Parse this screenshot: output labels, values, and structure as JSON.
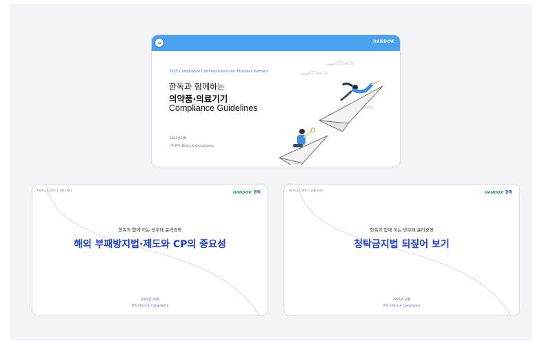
{
  "cards": [
    {
      "brand": "HANDOK",
      "subtitle": "2025 Compliance Communication for Business Partners",
      "title_line1": "한독과 함께하는",
      "title_line2": "의약품·의료기기",
      "title_line3": "Compliance Guidelines",
      "date": "2025년 8월",
      "org": "(주)한독 Ethics & Compliance"
    },
    {
      "tag": "[비즈니스 파트너 소통 자료]",
      "brand": "HANDOK",
      "brand_kr": "한독",
      "subtitle": "한독과 함께 하는 반부패 윤리경영",
      "title": "해외 부패방지법·제도와 CP의 중요성",
      "date": "2025년 11월",
      "org": "한독 Ethics & Compliance"
    },
    {
      "tag": "[비즈니스 파트너 소통 자료]",
      "brand": "HANDOK",
      "brand_kr": "한독",
      "subtitle": "한독과 함께 하는 반부패 윤리경영",
      "title": "청탁금지법 되짚어 보기",
      "date": "2025년 11월",
      "org": "한독 Ethics & Compliance"
    }
  ],
  "colors": {
    "accent": "#4aa3f0",
    "title_blue": "#1d3fd8",
    "brand_green": "#1f9a55"
  },
  "icons": [
    "chevron-down-icon",
    "paper-plane-illustration"
  ]
}
